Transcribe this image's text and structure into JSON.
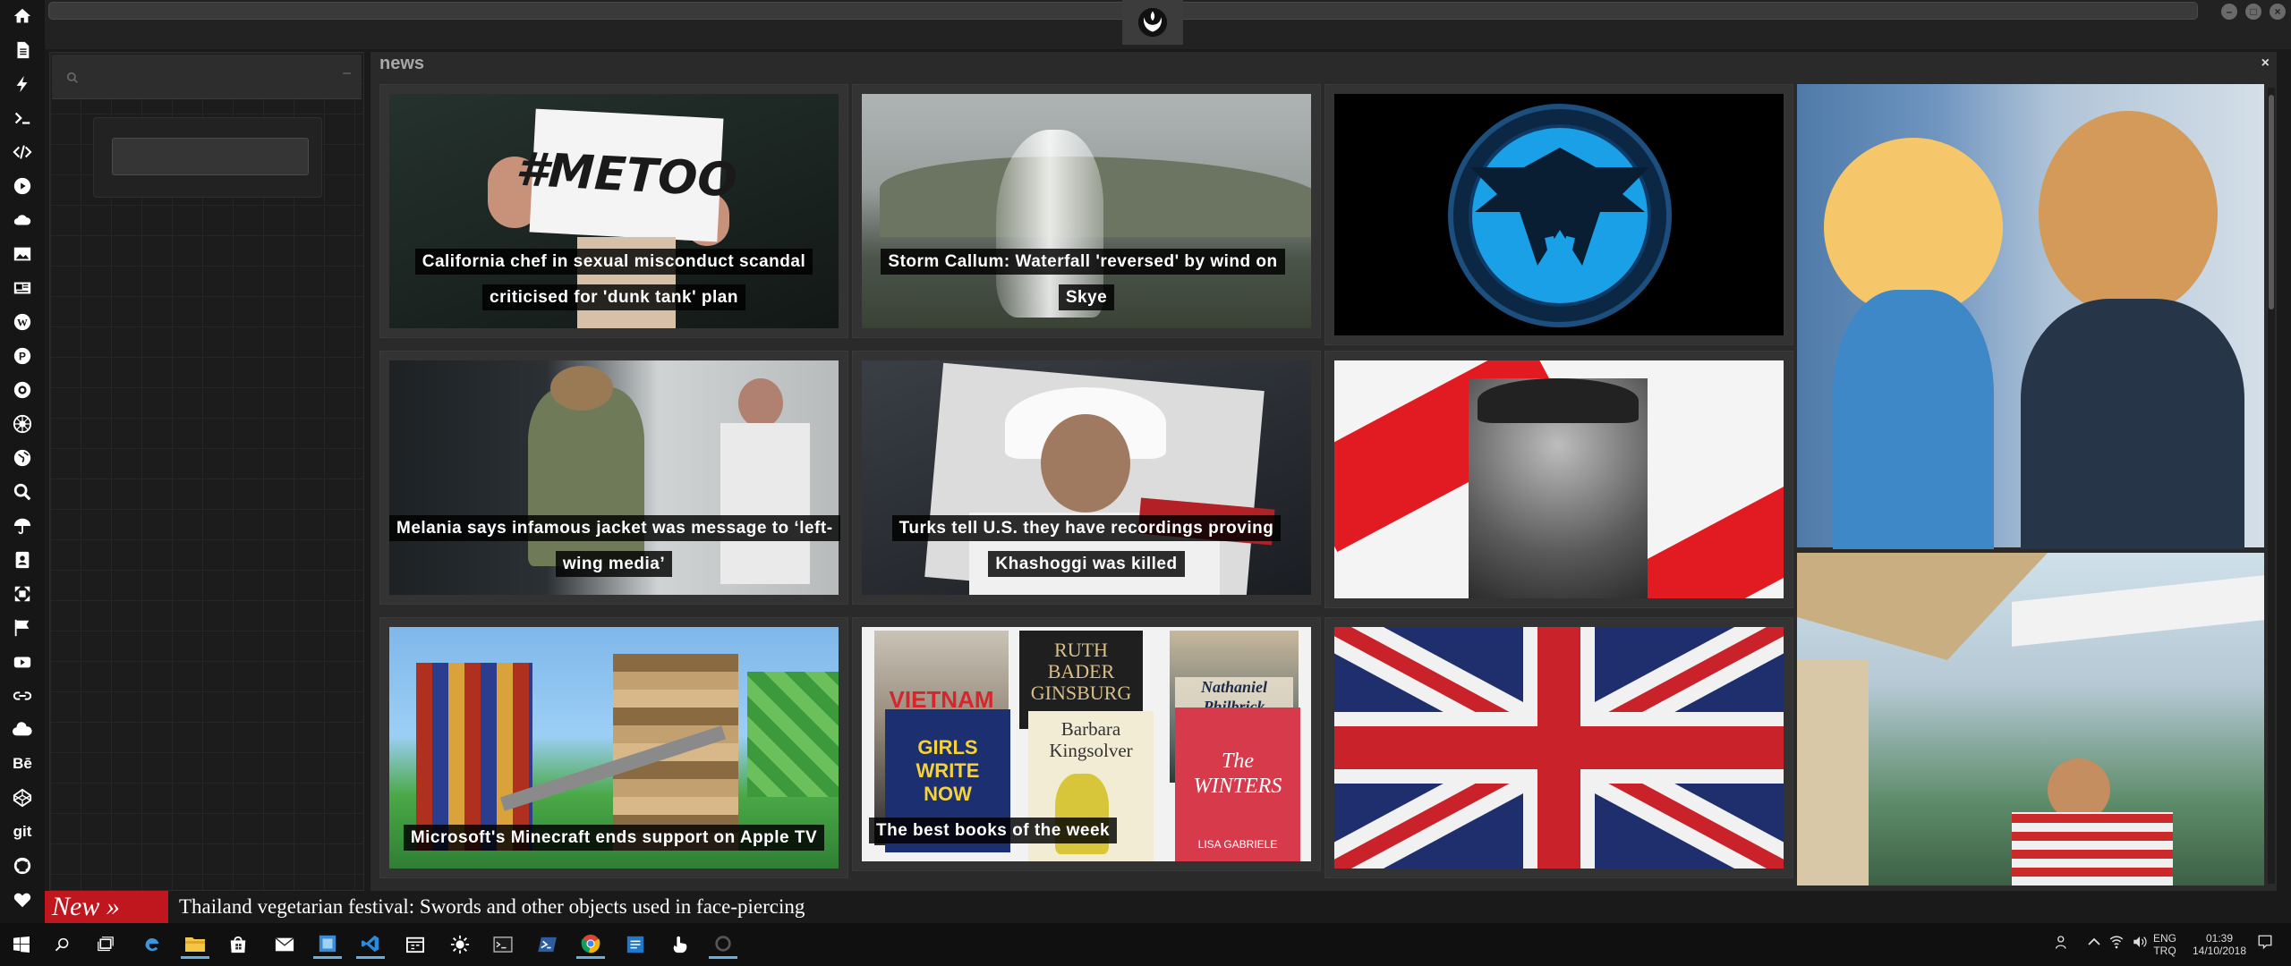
{
  "panel": {
    "title": "news",
    "close_label": "×"
  },
  "search": {
    "placeholder": "",
    "collapse_label": "–"
  },
  "iconbar": [
    "home-icon",
    "document-icon",
    "bolt-icon",
    "terminal-icon",
    "code-icon",
    "play-icon",
    "cloud-icon",
    "image-icon",
    "newspaper-icon",
    "wordpress-icon",
    "pinterest-icon",
    "rebel-icon",
    "empire-icon",
    "globe-icon",
    "search-icon",
    "umbrella-icon",
    "contact-icon",
    "expand-icon",
    "flag-icon",
    "youtube-icon",
    "link-icon",
    "cloud-alt-icon",
    "behance-icon",
    "codepen-icon",
    "git-icon",
    "github-icon",
    "heart-icon"
  ],
  "iconbar_text": {
    "behance": "Bē",
    "git": "git"
  },
  "articles": [
    {
      "caption": "California chef in sexual misconduct scandal criticised for 'dunk tank' plan",
      "image_text": "#METOO"
    },
    {
      "caption": "Storm Callum: Waterfall 'reversed' by wind on Skye"
    },
    {
      "caption": ""
    },
    {
      "caption": "Melania says infamous jacket was message to ‘left-wing media’"
    },
    {
      "caption": "Turks tell U.S. they have recordings proving Khashoggi was killed"
    },
    {
      "caption": ""
    },
    {
      "caption": "Microsoft's Minecraft ends support on Apple TV"
    },
    {
      "caption": "The best books of the week",
      "books": [
        "VIETNAM",
        "RUTH BADER GINSBURG",
        "Nathaniel Philbrick",
        "GIRLS WRITE NOW",
        "Barbara Kingsolver",
        "The WINTERS",
        "LISA GABRIELE"
      ]
    },
    {
      "caption": ""
    }
  ],
  "ticker": {
    "badge": "New »",
    "headline": "Thailand vegetarian festival: Swords and other objects used in face-piercing"
  },
  "taskbar": {
    "apps": [
      "start-icon",
      "search-icon",
      "task-view-icon",
      "edge-icon",
      "file-explorer-icon",
      "store-icon",
      "mail-icon",
      "app-icon",
      "vscode-icon",
      "calendar-icon",
      "sun-icon",
      "cmd-icon",
      "powershell-icon",
      "chrome-icon",
      "app-blue-icon",
      "touch-icon",
      "loading-icon"
    ],
    "lang": "ENG",
    "region": "TRQ",
    "time": "01:39",
    "date": "14/10/2018"
  },
  "colors": {
    "accent_red": "#c0161e",
    "bg": "#1a1a1a",
    "panel": "#2a2a2a"
  }
}
